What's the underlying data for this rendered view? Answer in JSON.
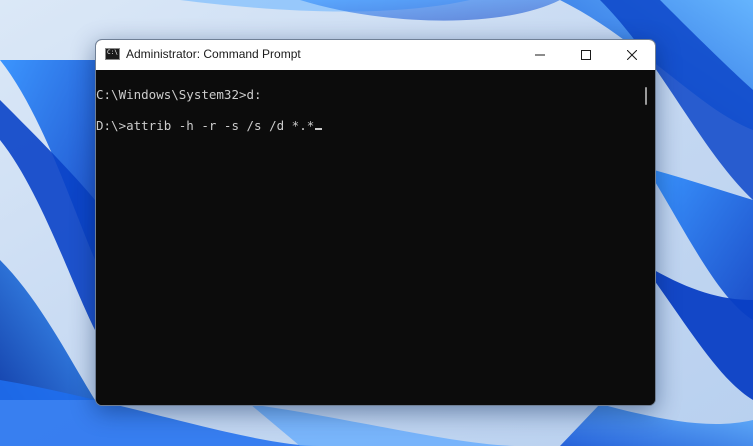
{
  "window": {
    "title": "Administrator: Command Prompt",
    "icon": "cmd-icon"
  },
  "caption_buttons": {
    "minimize_icon": "minimize-icon",
    "maximize_icon": "maximize-icon",
    "close_icon": "close-icon"
  },
  "console": {
    "lines": [
      "C:\\Windows\\System32>d:",
      "D:\\>attrib -h -r -s /s /d *.*"
    ],
    "text_color": "#cccccc",
    "background_color": "#0c0c0c"
  },
  "colors": {
    "titlebar": "#ffffff",
    "wallpaper_accent": "#1a5fe0"
  }
}
